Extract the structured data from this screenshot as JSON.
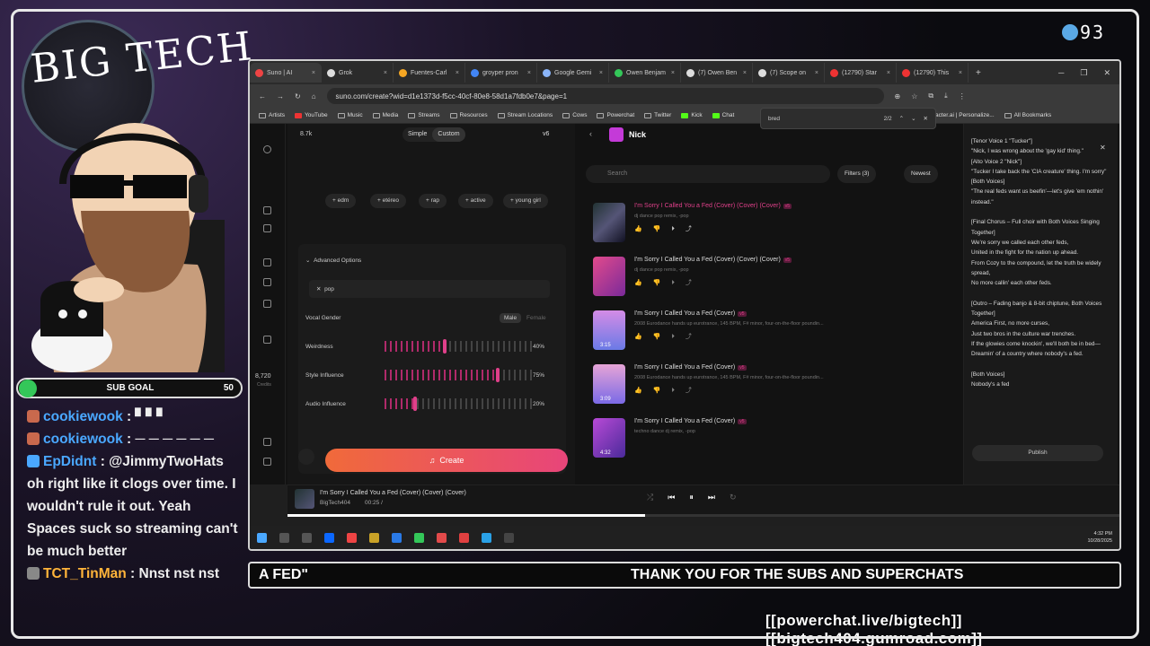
{
  "stream_overlay": {
    "logo_text": "BIG TECH",
    "viewer_count": "93",
    "sub_goal": {
      "label": "SUB GOAL",
      "count": "50"
    },
    "chat": [
      {
        "user": "cookiewook",
        "message": ": ▘▘▘"
      },
      {
        "user": "cookiewook",
        "message": ": ─ ─ ─ ─ ─ ─"
      },
      {
        "user": "EpDidnt",
        "message": ": @JimmyTwoHats oh right like it clogs over time. I wouldn't rule it out. Yeah Spaces suck so streaming can't be much better"
      },
      {
        "user": "TCT_TinMan",
        "message": ": Nnst nst nst"
      }
    ],
    "ticker_left": "A FED\"",
    "ticker_main": "THANK YOU FOR THE SUBS AND SUPERCHATS",
    "links": "[[powerchat.live/bigtech]] [[bigtech404.gumroad.com]]"
  },
  "browser": {
    "tabs": [
      {
        "label": "Suno | AI",
        "color": "#e44"
      },
      {
        "label": "Grok",
        "color": "#ddd"
      },
      {
        "label": "Fuentes-Carl",
        "color": "#f5a623"
      },
      {
        "label": "groyper pron",
        "color": "#4285f4"
      },
      {
        "label": "Google Gemi",
        "color": "#8ab4f8"
      },
      {
        "label": "Owen Benjam",
        "color": "#34c759"
      },
      {
        "label": "(7) Owen Ben",
        "color": "#ddd"
      },
      {
        "label": "(7) Scope on",
        "color": "#ddd"
      },
      {
        "label": "(12790) Star",
        "color": "#e33"
      },
      {
        "label": "(12790) This",
        "color": "#e33"
      }
    ],
    "url": "suno.com/create?wid=d1e1373d-f5cc-40cf-80e8-58d1a7fdb0e7&page=1",
    "bookmarks": [
      "Artists",
      "YouTube",
      "Music",
      "Media",
      "Streams",
      "Resources",
      "Stream Locations",
      "Cows",
      "Powerchat",
      "Twitter",
      "Kick",
      "Chat"
    ],
    "bookmarks_right": [
      "character.ai | Personalize...",
      "All Bookmarks"
    ],
    "find": {
      "query": "bred",
      "count": "2/2"
    }
  },
  "suno": {
    "credits_top": "8.7k",
    "mode_simple": "Simple",
    "mode_custom": "Custom",
    "version": "v6",
    "style_chips": [
      "edm",
      "etéreo",
      "rap",
      "active",
      "young girl"
    ],
    "advanced_label": "Advanced Options",
    "style_value": "pop",
    "vocal_gender": {
      "label": "Vocal Gender",
      "male": "Male",
      "female": "Female"
    },
    "sliders": [
      {
        "label": "Weirdness",
        "value": "40%",
        "level": 0.4
      },
      {
        "label": "Style Influence",
        "value": "75%",
        "level": 0.75
      },
      {
        "label": "Audio Influence",
        "value": "20%",
        "level": 0.2
      }
    ],
    "credits": "8,720",
    "credits_label": "Credits",
    "create_label": "Create",
    "workspace": "Nick",
    "search_placeholder": "Search",
    "filters": "Filters (3)",
    "sort": "Newest",
    "songs": [
      {
        "title": "I'm Sorry I Called You a Fed (Cover) (Cover) (Cover)",
        "desc": "dj dance pop remix, -pop",
        "tag": "v5",
        "dur": "",
        "hl": true
      },
      {
        "title": "I'm Sorry I Called You a Fed (Cover) (Cover) (Cover)",
        "desc": "dj dance pop remix, -pop",
        "tag": "v5",
        "dur": "",
        "hl": false
      },
      {
        "title": "I'm Sorry I Called You a Fed (Cover)",
        "desc": "2008 Eurodance hands up eurotrance, 145 BPM, F# minor, four-on-the-floor poundin...",
        "tag": "v5",
        "dur": "3:15",
        "hl": false
      },
      {
        "title": "I'm Sorry I Called You a Fed (Cover)",
        "desc": "2008 Eurodance hands up eurotrance, 145 BPM, F# minor, four-on-the-floor poundin...",
        "tag": "v5",
        "dur": "3:09",
        "hl": false
      },
      {
        "title": "I'm Sorry I Called You a Fed (Cover)",
        "desc": "techno dance dj remix, -pop",
        "tag": "v5",
        "dur": "4:32",
        "hl": false
      }
    ],
    "lyrics": [
      "[Tenor Voice 1 \"Tucker\"]",
      "\"Nick, I was wrong about the 'gay kid' thing.\"",
      "[Alto Voice 2 \"Nick\"]",
      "\"Tucker I take back the 'CIA creature' thing. I'm sorry\"",
      "[Both Voices]",
      "\"The real feds want us beefin'—let's give 'em nothin' instead.\"",
      "",
      "[Final Chorus – Full choir with Both Voices Singing Together]",
      "We're sorry we called each other feds,",
      "United in the fight for the nation up ahead.",
      "From Cozy to the compound, let the truth be widely spread,",
      "No more callin' each other feds.",
      "",
      "[Outro – Fading banjo & 8-bit chiptune, Both Voices Together]",
      "America First, no more curses,",
      "Just two bros in the culture war trenches.",
      "If the glowies come knockin', we'll both be in bed—",
      "Dreamin' of a country where nobody's a fed.",
      "",
      "[Both Voices]",
      "Nobody's a fed"
    ],
    "publish_label": "Publish",
    "player": {
      "title": "I'm Sorry I Called You a Fed (Cover) (Cover) (Cover)",
      "artist": "BigTech404",
      "time": "00:25 /",
      "progress": 0.43
    }
  },
  "taskbar": {
    "time": "4:32 PM",
    "date": "10/28/2025"
  },
  "colors": {
    "accent": "#e0408a",
    "create_start": "#f06a3a",
    "create_end": "#e8457a"
  }
}
